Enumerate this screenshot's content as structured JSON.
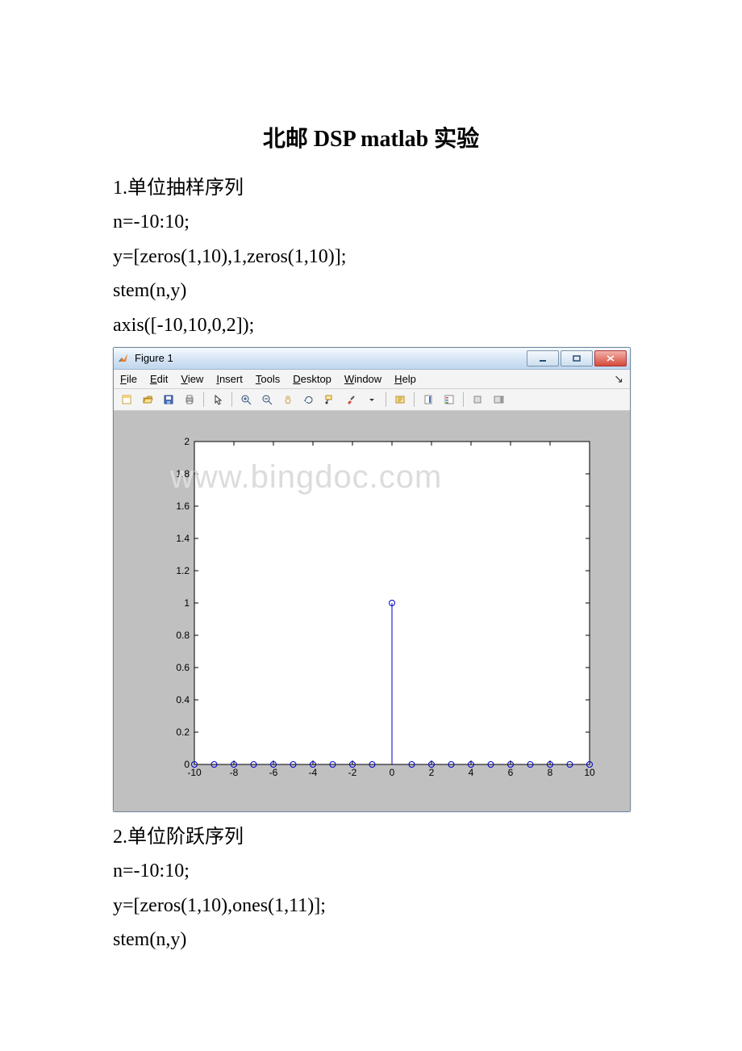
{
  "doc": {
    "title": "北邮 DSP matlab 实验",
    "p1": "1.单位抽样序列",
    "p2": "n=-10:10;",
    "p3": "y=[zeros(1,10),1,zeros(1,10)];",
    "p4": "stem(n,y)",
    "p5": "axis([-10,10,0,2]);",
    "p6": "2.单位阶跃序列",
    "p7": "n=-10:10;",
    "p8": "y=[zeros(1,10),ones(1,11)];",
    "p9": "stem(n,y)"
  },
  "figure": {
    "window_title": "Figure 1",
    "menus": {
      "file": "File",
      "edit": "Edit",
      "view": "View",
      "insert": "Insert",
      "tools": "Tools",
      "desktop": "Desktop",
      "window": "Window",
      "help": "Help"
    },
    "watermark": "www.bingdoc.com"
  },
  "chart_data": {
    "type": "bar",
    "categories": [
      -10,
      -9,
      -8,
      -7,
      -6,
      -5,
      -4,
      -3,
      -2,
      -1,
      0,
      1,
      2,
      3,
      4,
      5,
      6,
      7,
      8,
      9,
      10
    ],
    "values": [
      0,
      0,
      0,
      0,
      0,
      0,
      0,
      0,
      0,
      0,
      1,
      0,
      0,
      0,
      0,
      0,
      0,
      0,
      0,
      0,
      0
    ],
    "title": "",
    "xlabel": "",
    "ylabel": "",
    "xlim": [
      -10,
      10
    ],
    "ylim": [
      0,
      2
    ],
    "yticks": [
      0,
      0.2,
      0.4,
      0.6,
      0.8,
      1,
      1.2,
      1.4,
      1.6,
      1.8,
      2
    ],
    "xticks": [
      -10,
      -8,
      -6,
      -4,
      -2,
      0,
      2,
      4,
      6,
      8,
      10
    ]
  }
}
